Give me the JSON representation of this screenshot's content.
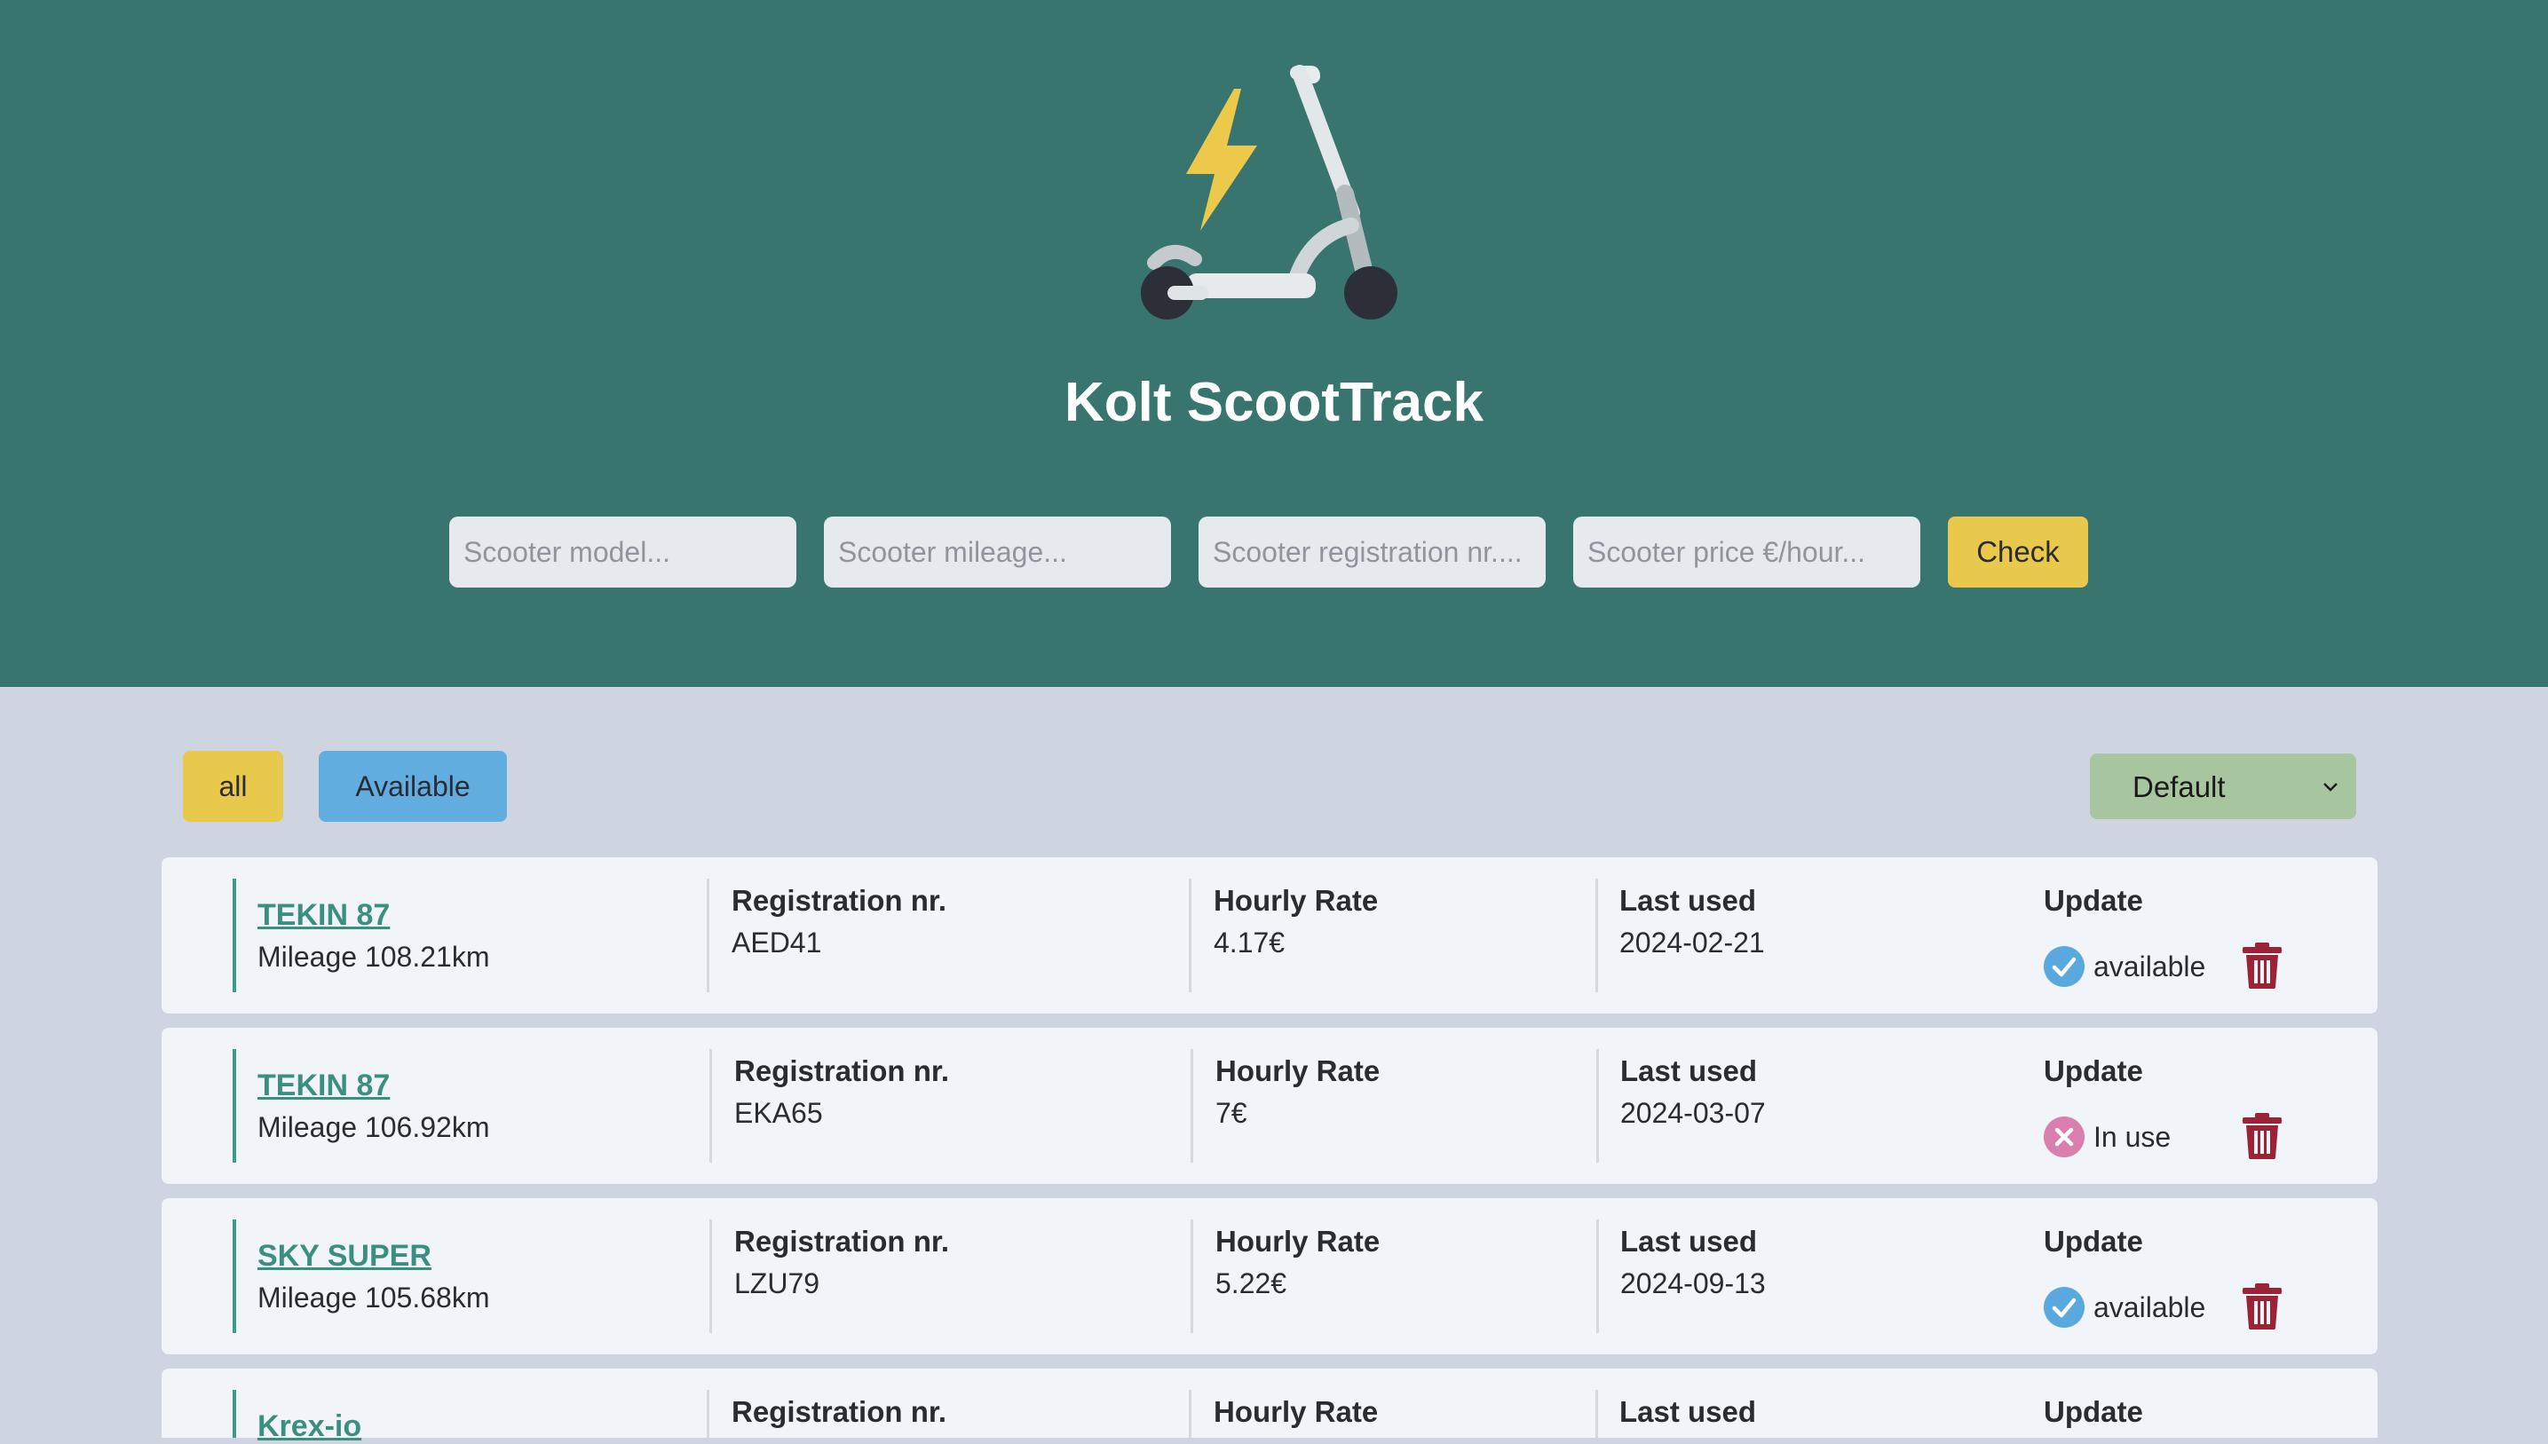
{
  "app": {
    "title": "Kolt ScootTrack"
  },
  "form": {
    "model_placeholder": "Scooter model...",
    "mileage_placeholder": "Scooter mileage...",
    "registration_placeholder": "Scooter registration nr....",
    "price_placeholder": "Scooter price €/hour...",
    "submit_label": "Check"
  },
  "filters": {
    "all_label": "all",
    "available_label": "Available"
  },
  "sort": {
    "selected": "Default"
  },
  "columns": {
    "registration": "Registration nr.",
    "rate": "Hourly Rate",
    "last_used": "Last used",
    "update": "Update"
  },
  "scooters": [
    {
      "model": "TEKIN 87",
      "mileage": "Mileage 108.21km",
      "registration": "AED41",
      "rate": "4.17€",
      "last_used": "2024-02-21",
      "status": "available"
    },
    {
      "model": "TEKIN 87",
      "mileage": "Mileage 106.92km",
      "registration": "EKA65",
      "rate": "7€",
      "last_used": "2024-03-07",
      "status": "In use"
    },
    {
      "model": "SKY SUPER",
      "mileage": "Mileage 105.68km",
      "registration": "LZU79",
      "rate": "5.22€",
      "last_used": "2024-09-13",
      "status": "available"
    },
    {
      "model": "Krex-io"
    }
  ],
  "colors": {
    "header_bg": "#37756e",
    "page_bg": "#cfd5e0",
    "accent_yellow": "#e8c94b",
    "accent_blue": "#62ade0",
    "sort_green": "#a7c59f",
    "link_green": "#3b8f80",
    "available_blue": "#5aa9de",
    "in_use_pink": "#d97fb0",
    "trash_red": "#9b2335"
  }
}
